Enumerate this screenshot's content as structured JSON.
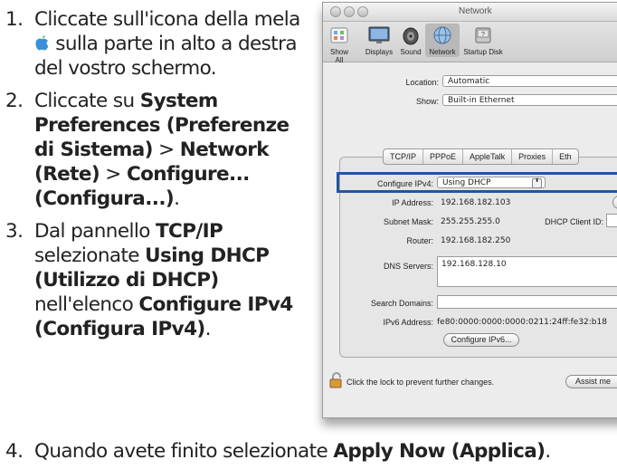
{
  "steps": [
    {
      "num": "1.",
      "text_a": "Cliccate sull'icona della mela ",
      "text_b": " sulla parte in alto a destra del vostro schermo."
    },
    {
      "num": "2.",
      "text_a": "Cliccate su ",
      "b1": "System Preferences (Preferenze di Sistema)",
      "s1": " > ",
      "b2": "Network (Rete)",
      "s2": " > ",
      "b3": "Configure... (Configura...)",
      "s3": "."
    },
    {
      "num": "3.",
      "text_a": "Dal pannello ",
      "b1": "TCP/IP",
      "s1": " selezionate ",
      "b2": "Using DHCP (Utilizzo di DHCP)",
      "s2": " nell'elenco ",
      "b3": "Configure IPv4 (Configura IPv4)",
      "s3": "."
    },
    {
      "num": "4.",
      "text_a": "Quando avete finito selezionate ",
      "b1": "Apply Now (Applica)",
      "s1": "."
    }
  ],
  "window": {
    "title": "Network",
    "toolbar": [
      "Show All",
      "Displays",
      "Sound",
      "Network",
      "Startup Disk"
    ],
    "location_label": "Location:",
    "location_value": "Automatic",
    "show_label": "Show:",
    "show_value": "Built-in Ethernet",
    "tabs": [
      "TCP/IP",
      "PPPoE",
      "AppleTalk",
      "Proxies",
      "Eth"
    ],
    "configure_label": "Configure IPv4:",
    "configure_value": "Using DHCP",
    "ip_label": "IP Address:",
    "ip_value": "192.168.182.103",
    "mask_label": "Subnet Mask:",
    "mask_value": "255.255.255.0",
    "dhcp_label": "DHCP Client ID:",
    "router_label": "Router:",
    "router_value": "192.168.182.250",
    "dns_label": "DNS Servers:",
    "dns_value": "192.168.128.10",
    "search_label": "Search Domains:",
    "ipv6_label": "IPv6 Address:",
    "ipv6_value": "fe80:0000:0000:0000:0211:24ff:fe32:b18",
    "configure_ipv6_button": "Configure IPv6...",
    "lock_text": "Click the lock to prevent further changes.",
    "assist_button": "Assist me",
    "ip_button_glyph": "(",
    "popup_arrows": "⬍"
  },
  "colors": {
    "highlight": "#20579d",
    "apple_icon": "#3b8fd6"
  },
  "icons": [
    "apple-icon",
    "displays-icon",
    "sound-icon",
    "network-icon",
    "startup-disk-icon",
    "lock-icon"
  ]
}
